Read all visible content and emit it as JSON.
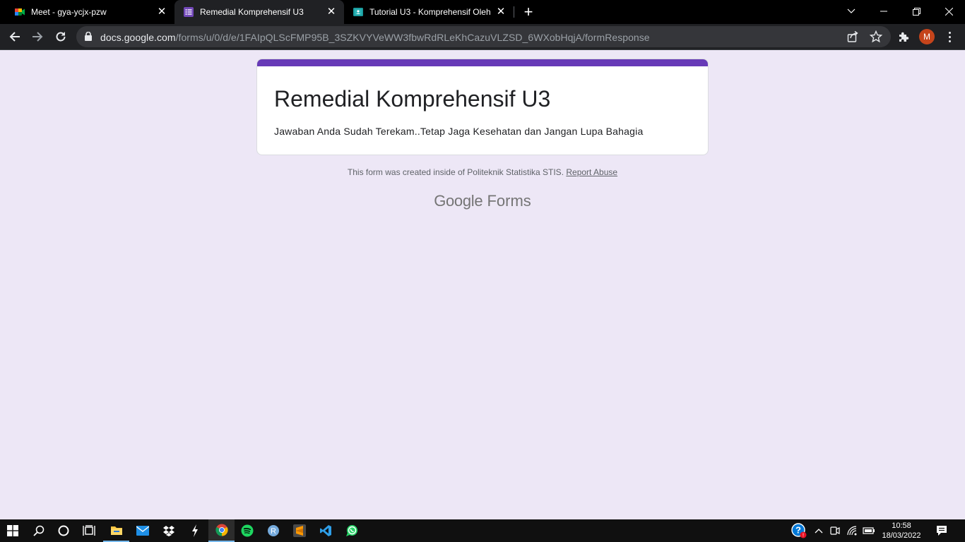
{
  "browser": {
    "tabs": [
      {
        "label": "Meet - gya-ycjx-pzw",
        "icon": "google-meet-icon",
        "active": false
      },
      {
        "label": "Remedial Komprehensif U3",
        "icon": "google-forms-icon",
        "active": true
      },
      {
        "label": "Tutorial U3 - Komprehensif Oleh",
        "icon": "google-classroom-icon",
        "active": false
      }
    ],
    "url_host": "docs.google.com",
    "url_path": "/forms/u/0/d/e/1FAIpQLScFMP95B_3SZKVYVeWW3fbwRdRLeKhCazuVLZSD_6WXobHqjA/formResponse",
    "profile_initial": "M",
    "accent_color": "#c5441b"
  },
  "form": {
    "title": "Remedial Komprehensif U3",
    "description": "Jawaban Anda Sudah Terekam..Tetap Jaga Kesehatan dan Jangan Lupa Bahagia",
    "footer_text": "This form was created inside of Politeknik Statistika STIS. ",
    "report_link": "Report Abuse",
    "logo_google": "Google",
    "logo_forms": " Forms",
    "accent_color": "#673ab7",
    "background_color": "#ede7f6"
  },
  "taskbar": {
    "time": "10:58",
    "date": "18/03/2022",
    "apps": [
      "start-icon",
      "search-icon",
      "cortana-icon",
      "task-view-icon",
      "file-explorer-icon",
      "mail-icon",
      "dropbox-icon",
      "app-icon",
      "chrome-icon",
      "spotify-icon",
      "r-icon",
      "sublime-text-icon",
      "vscode-icon",
      "whatsapp-icon"
    ]
  }
}
